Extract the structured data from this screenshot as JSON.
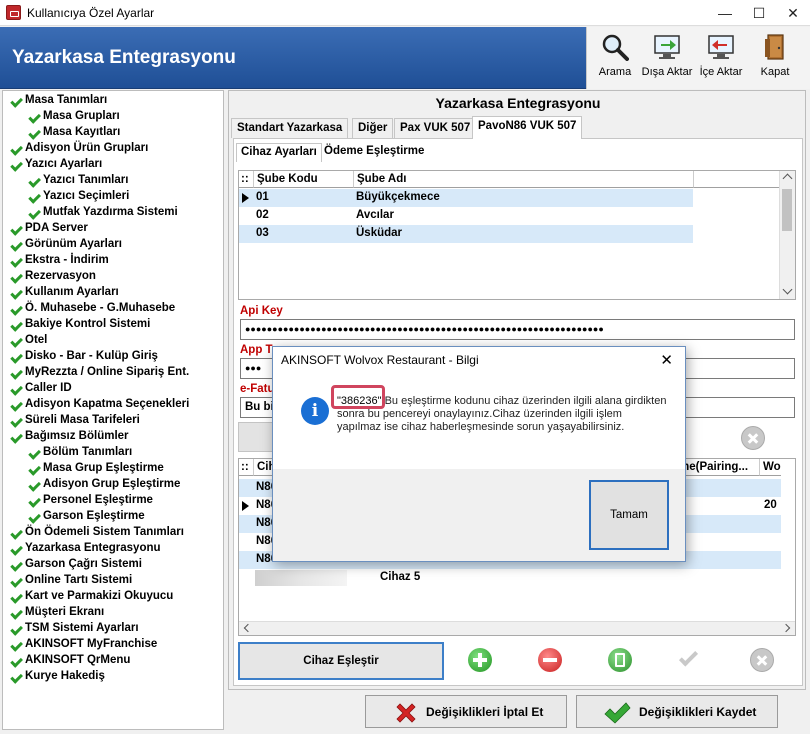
{
  "window": {
    "title": "Kullanıcıya Özel Ayarlar",
    "minimize": "—",
    "maximize": "☐",
    "close": "✕"
  },
  "header": {
    "title": "Yazarkasa Entegrasyonu"
  },
  "toolbar": [
    {
      "label": "Arama",
      "icon": "magnifier-icon"
    },
    {
      "label": "Dışa Aktar",
      "icon": "export-monitor-icon"
    },
    {
      "label": "İçe Aktar",
      "icon": "import-monitor-icon"
    },
    {
      "label": "Kapat",
      "icon": "book-exit-icon"
    }
  ],
  "tree": [
    {
      "label": "Masa Tanımları",
      "level": 0
    },
    {
      "label": "Masa Grupları",
      "level": 1
    },
    {
      "label": "Masa Kayıtları",
      "level": 1
    },
    {
      "label": "Adisyon Ürün Grupları",
      "level": 0
    },
    {
      "label": "Yazıcı Ayarları",
      "level": 0
    },
    {
      "label": "Yazıcı Tanımları",
      "level": 1
    },
    {
      "label": "Yazıcı Seçimleri",
      "level": 1
    },
    {
      "label": "Mutfak Yazdırma Sistemi",
      "level": 1
    },
    {
      "label": "PDA Server",
      "level": 0
    },
    {
      "label": "Görünüm Ayarları",
      "level": 0
    },
    {
      "label": "Ekstra - İndirim",
      "level": 0
    },
    {
      "label": "Rezervasyon",
      "level": 0
    },
    {
      "label": "Kullanım Ayarları",
      "level": 0
    },
    {
      "label": "Ö. Muhasebe - G.Muhasebe",
      "level": 0
    },
    {
      "label": "Bakiye Kontrol Sistemi",
      "level": 0
    },
    {
      "label": "Otel",
      "level": 0
    },
    {
      "label": "Disko - Bar - Kulüp Giriş",
      "level": 0
    },
    {
      "label": "MyRezzta / Online Sipariş Ent.",
      "level": 0
    },
    {
      "label": "Caller ID",
      "level": 0
    },
    {
      "label": "Adisyon Kapatma Seçenekleri",
      "level": 0
    },
    {
      "label": "Süreli Masa Tarifeleri",
      "level": 0
    },
    {
      "label": "Bağımsız Bölümler",
      "level": 0
    },
    {
      "label": "Bölüm Tanımları",
      "level": 1
    },
    {
      "label": "Masa Grup Eşleştirme",
      "level": 1
    },
    {
      "label": "Adisyon Grup Eşleştirme",
      "level": 1
    },
    {
      "label": "Personel Eşleştirme",
      "level": 1
    },
    {
      "label": "Garson Eşleştirme",
      "level": 1
    },
    {
      "label": "Ön Ödemeli Sistem Tanımları",
      "level": 0
    },
    {
      "label": "Yazarkasa Entegrasyonu",
      "level": 0
    },
    {
      "label": "Garson Çağrı Sistemi",
      "level": 0
    },
    {
      "label": "Online Tartı Sistemi",
      "level": 0
    },
    {
      "label": "Kart ve Parmakizi Okuyucu",
      "level": 0
    },
    {
      "label": "Müşteri Ekranı",
      "level": 0
    },
    {
      "label": "TSM Sistemi Ayarları",
      "level": 0
    },
    {
      "label": "AKINSOFT MyFranchise",
      "level": 0
    },
    {
      "label": "AKINSOFT QrMenu",
      "level": 0
    },
    {
      "label": "Kurye Hakediş",
      "level": 0
    }
  ],
  "main": {
    "title": "Yazarkasa Entegrasyonu",
    "tabs": [
      "Standart Yazarkasa",
      "Diğer",
      "Pax VUK 507",
      "PavoN86 VUK 507"
    ],
    "subtabs": [
      "Cihaz Ayarları",
      "Ödeme Eşleştirme"
    ],
    "grid1": {
      "marker": "::",
      "columns": [
        "Şube Kodu",
        "Şube Adı"
      ],
      "rows": [
        [
          "01",
          "Büyükçekmece"
        ],
        [
          "02",
          "Avcılar"
        ],
        [
          "03",
          "Üsküdar"
        ]
      ]
    },
    "api_key_label": "Api Key",
    "api_key_value": "●●●●●●●●●●●●●●●●●●●●●●●●●●●●●●●●●●●●●●●●●●●●●●●●●●●●●●●●●●●●●●●●●●",
    "app_label": "App T",
    "app_value": "●●●",
    "efatura_label": "e-Fatu",
    "efatura_value": "Bu bir",
    "grid2": {
      "marker": "::",
      "col_first": "Cih",
      "col_mid": "me(Pairing...",
      "col_last": "Wo",
      "rows": [
        "N86",
        "N86",
        "N86",
        "N86",
        "N86"
      ],
      "row6_name": "Cihaz 5",
      "row2_last": "20"
    },
    "pair_button": "Cihaz Eşleştir"
  },
  "footer": {
    "cancel": "Değişiklikleri İptal Et",
    "save": "Değişiklikleri Kaydet"
  },
  "dialog": {
    "title": "AKINSOFT Wolvox Restaurant - Bilgi",
    "info_glyph": "i",
    "code": "\"386236\"",
    "message": " Bu eşleştirme kodunu cihaz üzerinden ilgili alana girdikten sonra bu pencereyi onaylayınız.Cihaz üzerinden ilgili işlem yapılmaz ise cihaz haberleşmesinde sorun yaşayabilirsiniz.",
    "ok": "Tamam",
    "close": "✕"
  }
}
